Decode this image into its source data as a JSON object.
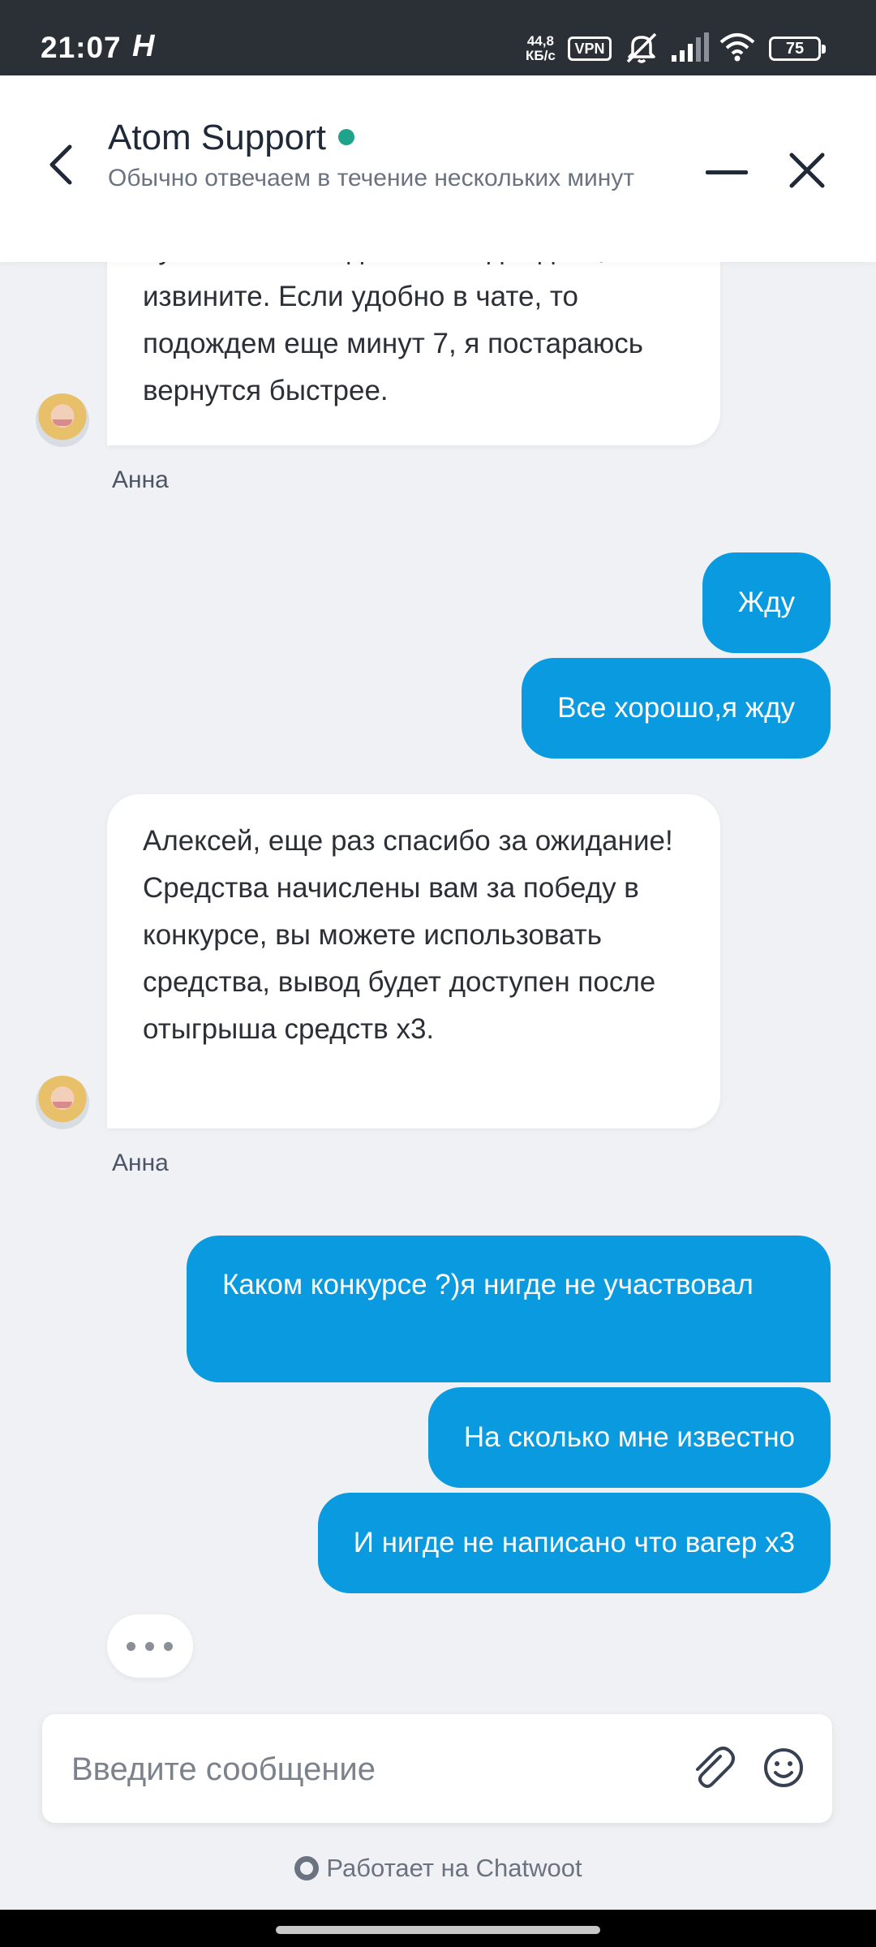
{
  "status_bar": {
    "time": "21:07",
    "h_label": "H",
    "speed": "44,8\nКБ/с",
    "vpn": "VPN",
    "battery": "75"
  },
  "header": {
    "title": "Atom Support",
    "subtitle": "Обычно отвечаем в течение нескольких минут",
    "online_color": "#1fa38a"
  },
  "messages": [
    {
      "from": "agent",
      "lines": "нужно немного дольше подождать, извините. Если удобно в чате, то подождем еще минут 7, я постараюсь вернутся быстрее.",
      "sender": "Анна"
    },
    {
      "from": "user",
      "text": "Жду"
    },
    {
      "from": "user",
      "text": "Все хорошо,я жду"
    },
    {
      "from": "agent",
      "lines": "Алексей, еще раз спасибо за ожидание! Средства начислены вам за победу в конкурсе, вы можете использовать средства, вывод будет доступен после отыгрыша средств x3.",
      "sender": "Анна"
    },
    {
      "from": "user",
      "text": "Каком конкурсе ?)я нигде не участвовал"
    },
    {
      "from": "user",
      "text": "На сколько мне известно"
    },
    {
      "from": "user",
      "text": "И нигде не написано что вагер x3"
    }
  ],
  "composer": {
    "placeholder": "Введите сообщение"
  },
  "powered_by": "Работает на Chatwoot",
  "colors": {
    "user_bubble": "#0a9ae0",
    "agent_bubble": "#ffffff",
    "background": "#f0f1f4"
  }
}
